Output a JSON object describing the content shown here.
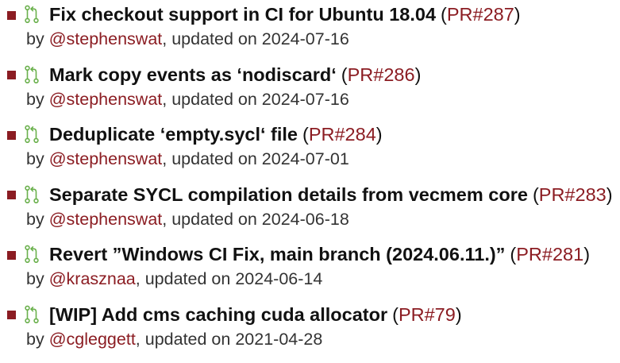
{
  "colors": {
    "accent": "#8b1c22",
    "pr_icon": "#6ab04c",
    "text": "#111111",
    "muted": "#333333"
  },
  "pull_requests": [
    {
      "title": "Fix checkout support in CI for Ubuntu 18.04",
      "pr_label": "PR#287",
      "by": "by",
      "author": "@stephenswat",
      "updated_prefix": ", updated on",
      "date": "2024-07-16",
      "icon": "pull-request-icon"
    },
    {
      "title": "Mark copy events as ‘nodiscard‘",
      "pr_label": "PR#286",
      "by": "by",
      "author": "@stephenswat",
      "updated_prefix": ", updated on",
      "date": "2024-07-16",
      "icon": "pull-request-icon"
    },
    {
      "title": "Deduplicate ‘empty.sycl‘ file",
      "pr_label": "PR#284",
      "by": "by",
      "author": "@stephenswat",
      "updated_prefix": ", updated on",
      "date": "2024-07-01",
      "icon": "pull-request-icon"
    },
    {
      "title": "Separate SYCL compilation details from vecmem core",
      "pr_label": "PR#283",
      "by": "by",
      "author": "@stephenswat",
      "updated_prefix": ", updated on",
      "date": "2024-06-18",
      "icon": "pull-request-icon"
    },
    {
      "title": "Revert ”Windows CI Fix, main branch (2024.06.11.)”",
      "pr_label": "PR#281",
      "by": "by",
      "author": "@krasznaa",
      "updated_prefix": ", updated on",
      "date": "2024-06-14",
      "icon": "pull-request-icon"
    },
    {
      "title": "[WIP] Add cms caching cuda allocator",
      "pr_label": "PR#79",
      "by": "by",
      "author": "@cgleggett",
      "updated_prefix": ", updated on",
      "date": "2021-04-28",
      "icon": "pull-request-icon"
    }
  ]
}
